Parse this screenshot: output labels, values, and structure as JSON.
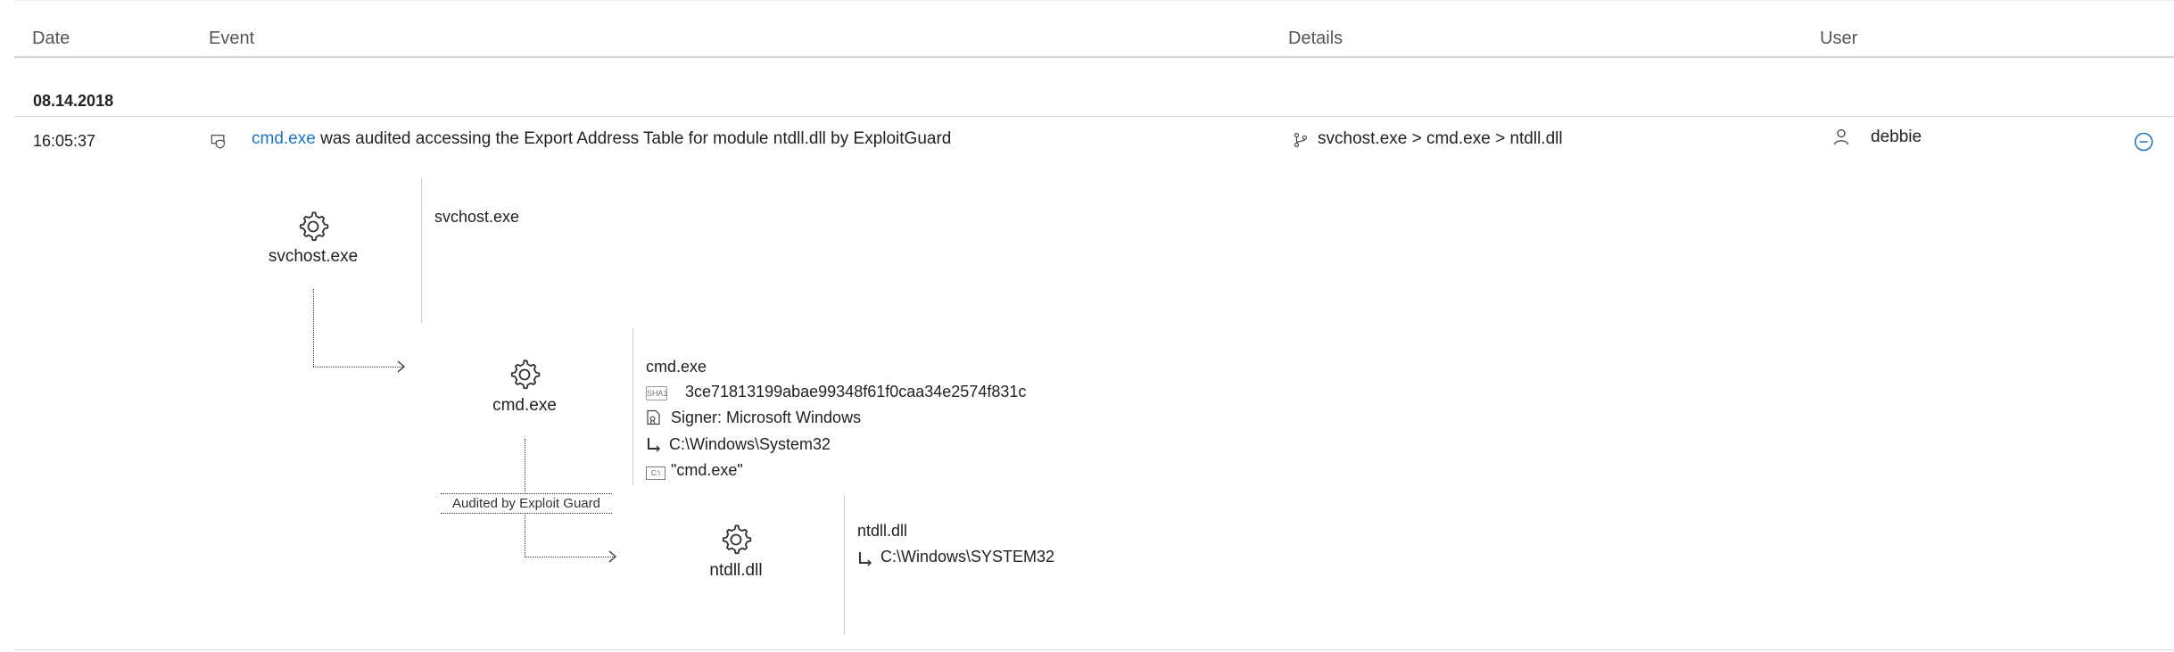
{
  "columns": {
    "date": "Date",
    "event": "Event",
    "details": "Details",
    "user": "User"
  },
  "group_date": "08.14.2018",
  "row": {
    "time": "16:05:37",
    "event_link": "cmd.exe",
    "event_text": " was audited accessing the Export Address Table for module ntdll.dll by ExploitGuard",
    "details": "svchost.exe > cmd.exe > ntdll.dll",
    "user": "debbie"
  },
  "tree": {
    "parent": {
      "name": "svchost.exe",
      "info_title": "svchost.exe"
    },
    "child": {
      "name": "cmd.exe",
      "info_title": "cmd.exe",
      "sha_tag": "SHA1",
      "sha1": "3ce71813199abae99348f61f0caa34e2574f831c",
      "signer": "Signer: Microsoft Windows",
      "path": "C:\\Windows\\System32",
      "cmdline_tag": "C:\\",
      "cmdline": "\"cmd.exe\""
    },
    "edge_label": "Audited by Exploit Guard",
    "module": {
      "name": "ntdll.dll",
      "info_title": "ntdll.dll",
      "path": "C:\\Windows\\SYSTEM32"
    }
  },
  "colors": {
    "link": "#1a73c7",
    "divider": "#d0d0d0",
    "text": "#222222"
  },
  "icons": {
    "event_type": "audit-shield-icon",
    "details": "process-tree-icon",
    "user": "person-icon",
    "collapse": "minus-circle-icon",
    "process": "gear-icon",
    "sha": "sha1-icon",
    "signer": "certificate-icon",
    "path": "folder-path-icon",
    "cmdline": "command-line-icon"
  }
}
